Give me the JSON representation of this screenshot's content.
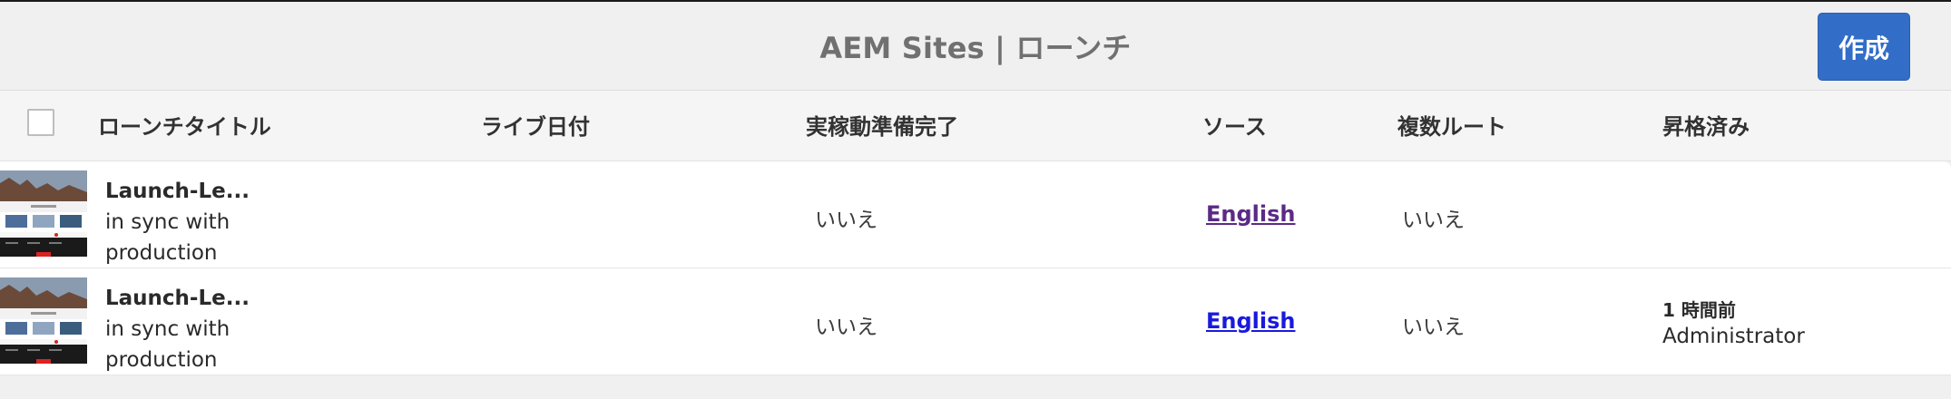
{
  "header": {
    "title": "AEM Sites | ローンチ",
    "create_label": "作成"
  },
  "columns": {
    "title": "ローンチタイトル",
    "live_date": "ライブ日付",
    "production_ready": "実稼動準備完了",
    "source": "ソース",
    "multiple_roots": "複数ルート",
    "promoted": "昇格済み"
  },
  "rows": [
    {
      "name": "Launch-Le...",
      "description": "in sync with production",
      "production_ready": "いいえ",
      "source": "English",
      "multiple_roots": "いいえ",
      "promoted_time": "",
      "promoted_by": ""
    },
    {
      "name": "Launch-Le...",
      "description": "in sync with production",
      "production_ready": "いいえ",
      "source": "English",
      "multiple_roots": "いいえ",
      "promoted_time": "1 時間前",
      "promoted_by": "Administrator"
    }
  ],
  "colors": {
    "accent": "#326ec8",
    "link_visited": "#5b2a86",
    "link": "#1a1adc"
  }
}
